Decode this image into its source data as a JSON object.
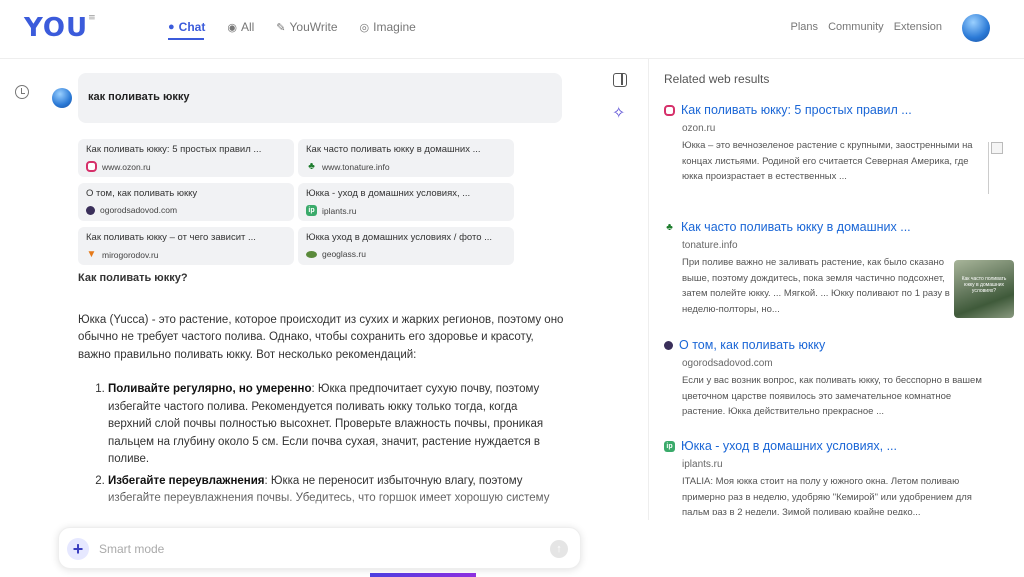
{
  "header": {
    "logo_text": "YOU",
    "nav": [
      {
        "label": "Chat",
        "icon": "chat-icon",
        "active": true
      },
      {
        "label": "All",
        "icon": "globe-icon",
        "active": false
      },
      {
        "label": "YouWrite",
        "icon": "pen-icon",
        "active": false
      },
      {
        "label": "Imagine",
        "icon": "camera-icon",
        "active": false
      }
    ],
    "right_links": [
      "Plans",
      "Community",
      "Extension"
    ]
  },
  "query": "как поливать юкку",
  "sources": [
    {
      "title": "Как поливать юкку: 5 простых правил ...",
      "domain": "www.ozon.ru",
      "favicon": "ozon-icon"
    },
    {
      "title": "Как часто поливать юкку в домашних ...",
      "domain": "www.tonature.info",
      "favicon": "clover-icon"
    },
    {
      "title": "О том, как поливать юкку",
      "domain": "ogorodsadovod.com",
      "favicon": "ogorod-icon"
    },
    {
      "title": "Юкка - уход в домашних условиях, ...",
      "domain": "iplants.ru",
      "favicon": "iplants-icon"
    },
    {
      "title": "Как поливать юкку – от чего зависит ...",
      "domain": "mirogorodov.ru",
      "favicon": "carrot-icon"
    },
    {
      "title": "Юкка уход в домашних условиях / фото ...",
      "domain": "geoglass.ru",
      "favicon": "geoglass-icon"
    }
  ],
  "answer": {
    "heading": "Как поливать юкку?",
    "intro": "Юкка (Yucca) - это растение, которое происходит из сухих и жарких регионов, поэтому оно обычно не требует частого полива. Однако, чтобы сохранить его здоровье и красоту, важно правильно поливать юкку. Вот несколько рекомендаций:",
    "items": [
      {
        "bold": "Поливайте регулярно, но умеренно",
        "text": ": Юкка предпочитает сухую почву, поэтому избегайте частого полива. Рекомендуется поливать юкку только тогда, когда верхний слой почвы полностью высохнет. Проверьте влажность почвы, проникая пальцем на глубину около 5 см. Если почва сухая, значит, растение нуждается в поливе."
      },
      {
        "bold": "Избегайте переувлажнения",
        "text": ": Юкка не переносит избыточную влагу, поэтому избегайте переувлажнения почвы. Убедитесь, что горшок имеет хорошую систему"
      }
    ]
  },
  "input": {
    "placeholder": "Smart mode",
    "value": ""
  },
  "related": {
    "title": "Related web results",
    "results": [
      {
        "title": "Как поливать юкку: 5 простых правил ...",
        "domain": "ozon.ru",
        "favicon": "ozon-icon",
        "snippet": "Юкка – это вечнозеленое растение с крупными, заостренными на концах листьями. Родиной его считается Северная Америка, где юкка произрастает в естественных ..."
      },
      {
        "title": "Как часто поливать юкку в домашних ...",
        "domain": "tonature.info",
        "favicon": "clover-icon",
        "snippet": "При поливе важно не заливать растение, как было сказано выше, поэтому дождитесь, пока земля частично подсохнет, затем полейте юкку. ... Мягкой. ... Юкку поливают по 1 разу в неделю-полторы, но..."
      },
      {
        "title": "О том, как поливать юкку",
        "domain": "ogorodsadovod.com",
        "favicon": "ogorod-icon",
        "snippet": "Если у вас возник вопрос, как поливать юкку, то бесспорно в вашем цветочном царстве появилось это замечательное комнатное растение. Юкка действительно прекрасное ..."
      },
      {
        "title": "Юкка - уход в домашних условиях, ...",
        "domain": "iplants.ru",
        "favicon": "iplants-icon",
        "snippet": "ITALIA: Моя юкка стоит на полу у южного окна. Летом поливаю примерно раз в неделю, удобряю \"Кемирой\" или удобрением для пальм раз в 2 недели. Зимой поливаю крайне редко..."
      }
    ],
    "thumb_caption": "Как часто поливать юкку в домашних условиях?"
  }
}
